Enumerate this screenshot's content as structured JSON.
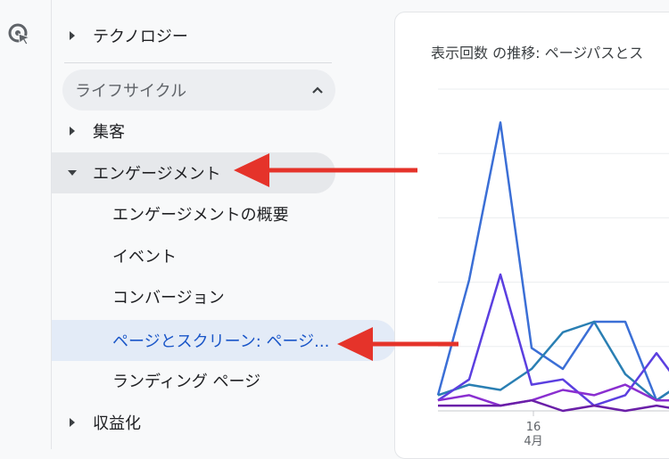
{
  "nav": {
    "item_technology": "テクノロジー",
    "section_lifecycle": "ライフサイクル",
    "item_acquisition": "集客",
    "item_engagement": "エンゲージメント",
    "sub_engagement_overview": "エンゲージメントの概要",
    "sub_events": "イベント",
    "sub_conversions": "コンバージョン",
    "sub_pages_screens": "ページとスクリーン: ページ...",
    "sub_landing_page": "ランディング ページ",
    "item_monetization": "収益化"
  },
  "card": {
    "title": "表示回数 の推移: ページパスとス"
  },
  "chart_data": {
    "type": "line",
    "title": "表示回数 の推移: ページパスとス",
    "x_ticks": [
      {
        "label": "16",
        "sub": "4月"
      }
    ],
    "grid": true,
    "series": [
      {
        "color": "#3b6fd6",
        "values": [
          3,
          25,
          55,
          12,
          8,
          17,
          17,
          2,
          6
        ]
      },
      {
        "color": "#2a7fb3",
        "values": [
          3,
          5,
          4,
          8,
          15,
          17,
          7,
          2,
          6
        ]
      },
      {
        "color": "#5b3fe0",
        "values": [
          2,
          6,
          26,
          5,
          6,
          1,
          3,
          11,
          3
        ]
      },
      {
        "color": "#8a2fd0",
        "values": [
          2,
          3,
          1,
          2,
          4,
          3,
          5,
          2,
          2
        ]
      },
      {
        "color": "#6a1fa8",
        "values": [
          1,
          1,
          1,
          2,
          0,
          1,
          0,
          1,
          0
        ]
      }
    ]
  },
  "colors": {
    "annotation_arrow": "#e5332a",
    "selected_text": "#1a56c8",
    "rail_icon": "#5f6368"
  }
}
